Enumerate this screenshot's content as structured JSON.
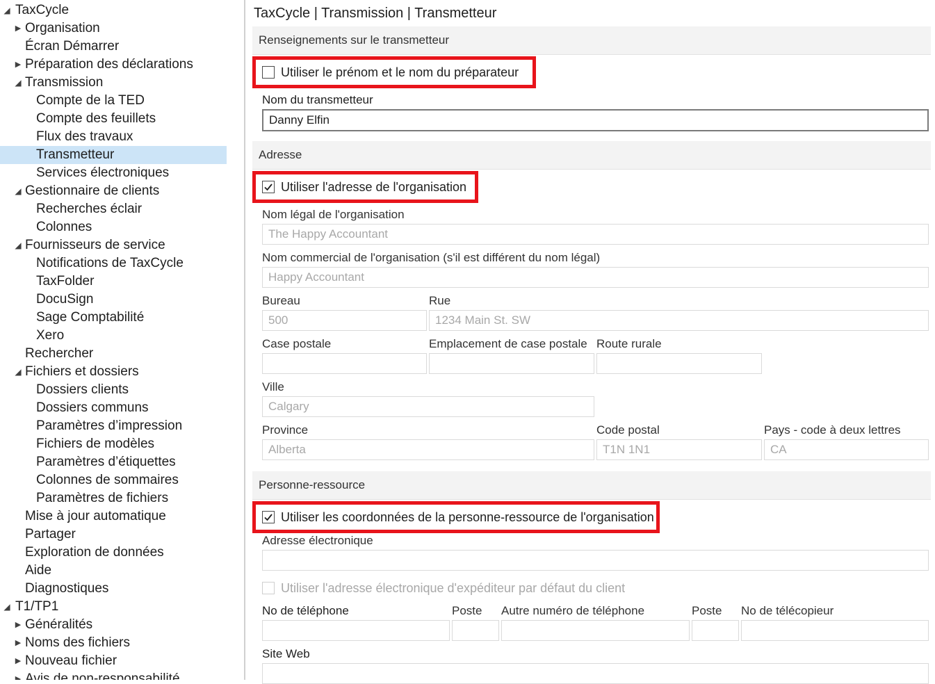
{
  "tree": [
    {
      "label": "TaxCycle",
      "level": 0,
      "arrow": "expanded"
    },
    {
      "label": "Organisation",
      "level": 1,
      "arrow": "collapsed"
    },
    {
      "label": "Écran Démarrer",
      "level": 1,
      "arrow": "none"
    },
    {
      "label": "Préparation des déclarations",
      "level": 1,
      "arrow": "collapsed"
    },
    {
      "label": "Transmission",
      "level": 1,
      "arrow": "expanded"
    },
    {
      "label": "Compte de la TED",
      "level": 2,
      "arrow": "none"
    },
    {
      "label": "Compte des feuillets",
      "level": 2,
      "arrow": "none"
    },
    {
      "label": "Flux des travaux",
      "level": 2,
      "arrow": "none"
    },
    {
      "label": "Transmetteur",
      "level": 2,
      "arrow": "none",
      "selected": true
    },
    {
      "label": "Services électroniques",
      "level": 2,
      "arrow": "none"
    },
    {
      "label": "Gestionnaire de clients",
      "level": 1,
      "arrow": "expanded"
    },
    {
      "label": "Recherches éclair",
      "level": 2,
      "arrow": "none"
    },
    {
      "label": "Colonnes",
      "level": 2,
      "arrow": "none"
    },
    {
      "label": "Fournisseurs de service",
      "level": 1,
      "arrow": "expanded"
    },
    {
      "label": "Notifications de TaxCycle",
      "level": 2,
      "arrow": "none"
    },
    {
      "label": "TaxFolder",
      "level": 2,
      "arrow": "none"
    },
    {
      "label": "DocuSign",
      "level": 2,
      "arrow": "none"
    },
    {
      "label": "Sage Comptabilité",
      "level": 2,
      "arrow": "none"
    },
    {
      "label": "Xero",
      "level": 2,
      "arrow": "none"
    },
    {
      "label": "Rechercher",
      "level": 1,
      "arrow": "none"
    },
    {
      "label": "Fichiers et dossiers",
      "level": 1,
      "arrow": "expanded"
    },
    {
      "label": "Dossiers clients",
      "level": 2,
      "arrow": "none"
    },
    {
      "label": "Dossiers communs",
      "level": 2,
      "arrow": "none"
    },
    {
      "label": "Paramètres d’impression",
      "level": 2,
      "arrow": "none"
    },
    {
      "label": "Fichiers de modèles",
      "level": 2,
      "arrow": "none"
    },
    {
      "label": "Paramètres d’étiquettes",
      "level": 2,
      "arrow": "none"
    },
    {
      "label": "Colonnes de sommaires",
      "level": 2,
      "arrow": "none"
    },
    {
      "label": "Paramètres de fichiers",
      "level": 2,
      "arrow": "none"
    },
    {
      "label": "Mise à jour automatique",
      "level": 1,
      "arrow": "none"
    },
    {
      "label": "Partager",
      "level": 1,
      "arrow": "none"
    },
    {
      "label": "Exploration de données",
      "level": 1,
      "arrow": "none"
    },
    {
      "label": "Aide",
      "level": 1,
      "arrow": "none"
    },
    {
      "label": "Diagnostiques",
      "level": 1,
      "arrow": "none"
    },
    {
      "label": "T1/TP1",
      "level": 0,
      "arrow": "expanded"
    },
    {
      "label": "Généralités",
      "level": 1,
      "arrow": "collapsed"
    },
    {
      "label": "Noms des fichiers",
      "level": 1,
      "arrow": "collapsed"
    },
    {
      "label": "Nouveau fichier",
      "level": 1,
      "arrow": "collapsed"
    },
    {
      "label": "Avis de non-responsabilité",
      "level": 1,
      "arrow": "collapsed"
    }
  ],
  "panel": {
    "title": "TaxCycle | Transmission | Transmetteur",
    "sections": {
      "transmitter": "Renseignements sur le transmetteur",
      "address": "Adresse",
      "contact": "Personne-ressource"
    },
    "use_preparer_name": {
      "label": "Utiliser le prénom et le nom du préparateur",
      "checked": false
    },
    "transmitter_name": {
      "label": "Nom du transmetteur",
      "value": "Danny Elfin"
    },
    "use_org_address": {
      "label": "Utiliser l'adresse de l'organisation",
      "checked": true
    },
    "legal_name": {
      "label": "Nom légal de l'organisation",
      "value": "The Happy Accountant"
    },
    "trade_name": {
      "label": "Nom commercial de l'organisation (s'il est différent du nom légal)",
      "value": "Happy Accountant"
    },
    "suite": {
      "label": "Bureau",
      "value": "500"
    },
    "street": {
      "label": "Rue",
      "value": "1234 Main St. SW"
    },
    "po_box": {
      "label": "Case postale",
      "value": ""
    },
    "po_box_location": {
      "label": "Emplacement de case postale",
      "value": ""
    },
    "rural_route": {
      "label": "Route rurale",
      "value": ""
    },
    "city": {
      "label": "Ville",
      "value": "Calgary"
    },
    "province": {
      "label": "Province",
      "value": "Alberta"
    },
    "postal_code": {
      "label": "Code postal",
      "value": "T1N 1N1"
    },
    "country": {
      "label": "Pays - code à deux lettres",
      "value": "CA"
    },
    "use_org_contact": {
      "label": "Utiliser les coordonnées de la personne-ressource de l'organisation",
      "checked": true
    },
    "email": {
      "label": "Adresse électronique",
      "value": ""
    },
    "use_default_sender": {
      "label": "Utiliser l'adresse électronique d'expéditeur par défaut du client",
      "checked": false,
      "disabled": true
    },
    "phone": {
      "label": "No de téléphone",
      "value": ""
    },
    "phone_ext": {
      "label": "Poste",
      "value": ""
    },
    "alt_phone": {
      "label": "Autre numéro de téléphone",
      "value": ""
    },
    "alt_phone_ext": {
      "label": "Poste",
      "value": ""
    },
    "fax": {
      "label": "No de télécopieur",
      "value": ""
    },
    "website": {
      "label": "Site Web",
      "value": ""
    }
  },
  "colors": {
    "highlight": "#e8141b",
    "selection": "#cce4f7",
    "section_bg": "#f3f3f3"
  }
}
